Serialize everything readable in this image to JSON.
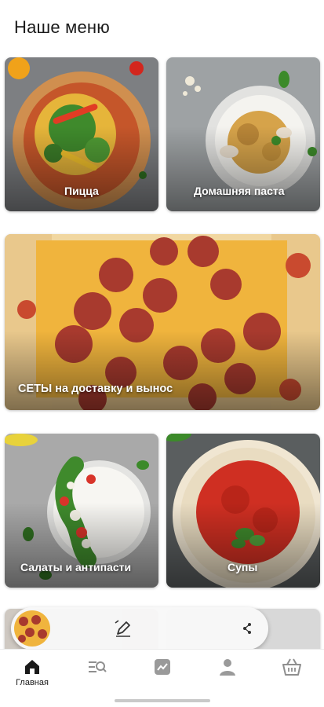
{
  "header": {
    "title": "Наше меню"
  },
  "categories": {
    "pizza": "Пицца",
    "pasta": "Домашняя паста",
    "sets": "СЕТЫ на доставку и вынос",
    "salads": "Салаты и антипасти",
    "soups": "Супы"
  },
  "bottom_nav": {
    "home": {
      "label": "Главная",
      "icon": "home-icon"
    },
    "menu": {
      "icon": "menu-search-icon"
    },
    "promo": {
      "icon": "trending-icon"
    },
    "profile": {
      "icon": "user-icon"
    },
    "cart": {
      "icon": "basket-icon"
    }
  },
  "colors": {
    "accent": "#1a1a1a",
    "inactive_icon": "#9a9a9a",
    "card_text": "#ffffff"
  }
}
